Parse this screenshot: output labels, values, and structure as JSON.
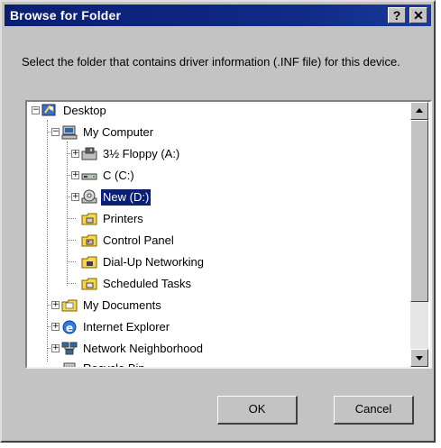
{
  "window": {
    "title": "Browse for Folder",
    "help_label": "?",
    "close_label": "✕"
  },
  "prompt": "Select the folder that contains driver information (.INF file) for this device.",
  "tree": {
    "items": [
      {
        "label": "Desktop",
        "icon": "desktop-icon"
      },
      {
        "label": "My Computer",
        "icon": "computer-icon"
      },
      {
        "label": "3½ Floppy (A:)",
        "icon": "floppy-icon"
      },
      {
        "label": "C (C:)",
        "icon": "hard-drive-icon"
      },
      {
        "label": "New (D:)",
        "icon": "cdrom-icon",
        "selected": true
      },
      {
        "label": "Printers",
        "icon": "printers-folder-icon"
      },
      {
        "label": "Control Panel",
        "icon": "control-panel-folder-icon"
      },
      {
        "label": "Dial-Up Networking",
        "icon": "dialup-folder-icon"
      },
      {
        "label": "Scheduled Tasks",
        "icon": "scheduled-tasks-folder-icon"
      },
      {
        "label": "My Documents",
        "icon": "folder-icon"
      },
      {
        "label": "Internet Explorer",
        "icon": "internet-explorer-icon"
      },
      {
        "label": "Network Neighborhood",
        "icon": "network-icon"
      },
      {
        "label": "Recycle Bin",
        "icon": "recycle-bin-icon"
      }
    ]
  },
  "buttons": {
    "ok": "OK",
    "cancel": "Cancel"
  },
  "colors": {
    "titlebar": "#0a1f73",
    "face": "#c3c3c3",
    "selection": "#0a1f73"
  }
}
